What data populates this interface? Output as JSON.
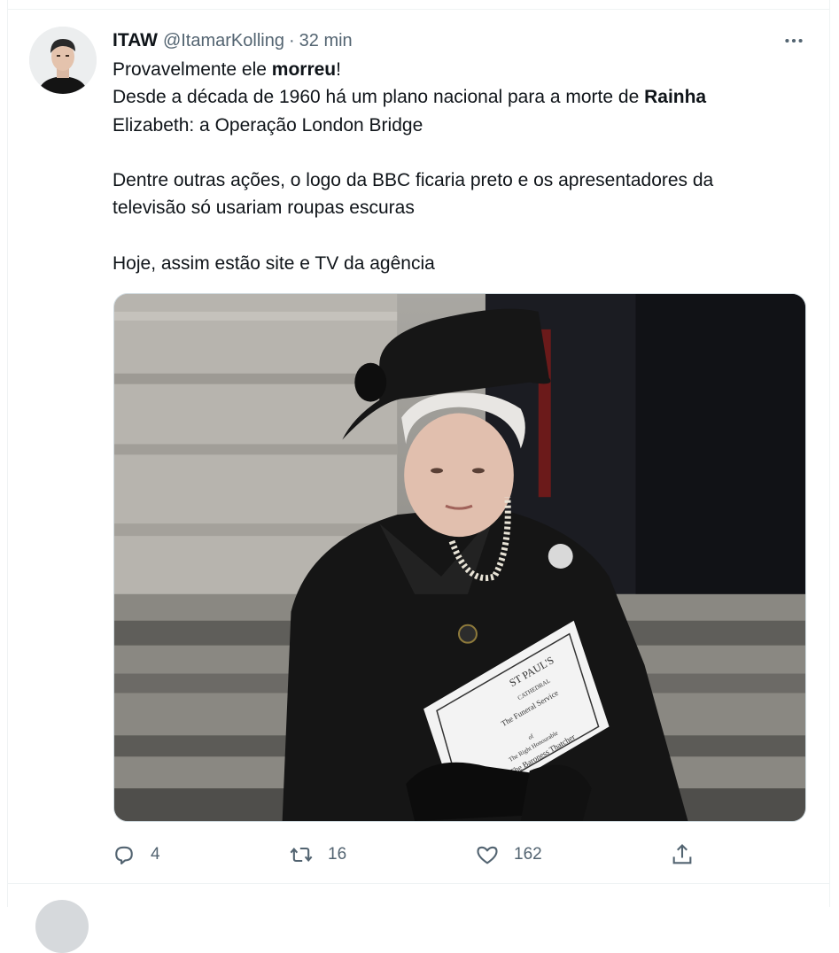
{
  "tweet": {
    "author_name": "ITAW",
    "author_handle": "@ItamarKolling",
    "separator": "·",
    "time": "32 min",
    "lines": {
      "l1_pre": "Provavelmente ele ",
      "l1_bold": "morreu",
      "l1_post": "!",
      "l2_pre": "Desde a década de 1960 há um plano nacional para a morte de ",
      "l2_bold": "Rainha",
      "l3": "Elizabeth: a Operação London Bridge",
      "l4": "Dentre outras ações, o logo da BBC ficaria preto e os apresentadores da",
      "l5": "televisão só usariam roupas escuras",
      "l6": "Hoje, assim estão site e TV da agência"
    },
    "media_text": {
      "program_title": "ST PAUL'S",
      "program_sub": "CATHEDRAL",
      "program_line1": "The Funeral Service",
      "program_line2": "of",
      "program_line3": "The Right Honourable",
      "program_line4": "The Baroness Thatcher"
    }
  },
  "actions": {
    "reply_count": "4",
    "retweet_count": "16",
    "like_count": "162"
  },
  "colors": {
    "text": "#0f1419",
    "secondary": "#536471",
    "border": "#eff3f4"
  },
  "icons": [
    "more-icon",
    "reply-icon",
    "retweet-icon",
    "like-icon",
    "share-icon"
  ]
}
